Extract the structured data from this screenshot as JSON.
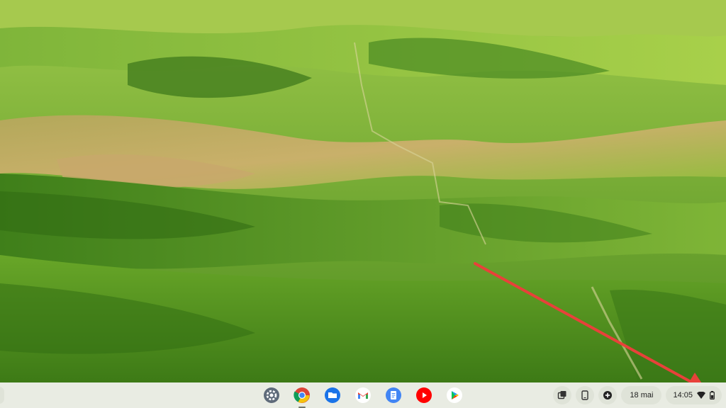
{
  "wallpaper": {
    "name": "rolling-green-hills"
  },
  "shelf": {
    "apps": [
      {
        "name": "settings",
        "icon": "gear-icon",
        "active": false
      },
      {
        "name": "chrome",
        "icon": "chrome-icon",
        "active": true
      },
      {
        "name": "files",
        "icon": "folder-icon",
        "active": false
      },
      {
        "name": "gmail",
        "icon": "gmail-icon",
        "active": false
      },
      {
        "name": "docs",
        "icon": "docs-icon",
        "active": false
      },
      {
        "name": "youtube",
        "icon": "youtube-icon",
        "active": false
      },
      {
        "name": "play-store",
        "icon": "play-store-icon",
        "active": false
      }
    ],
    "tray": {
      "date": "18 mai",
      "time": "14:05",
      "icons": [
        "screen-capture-icon",
        "phone-hub-icon",
        "add-note-icon",
        "wifi-icon",
        "battery-icon"
      ]
    }
  },
  "annotation": {
    "type": "arrow",
    "color": "#e8413a"
  },
  "colors": {
    "shelf": "#e9ece3",
    "tray_pill": "#dfe3d8",
    "accent_arrow": "#e8413a"
  }
}
